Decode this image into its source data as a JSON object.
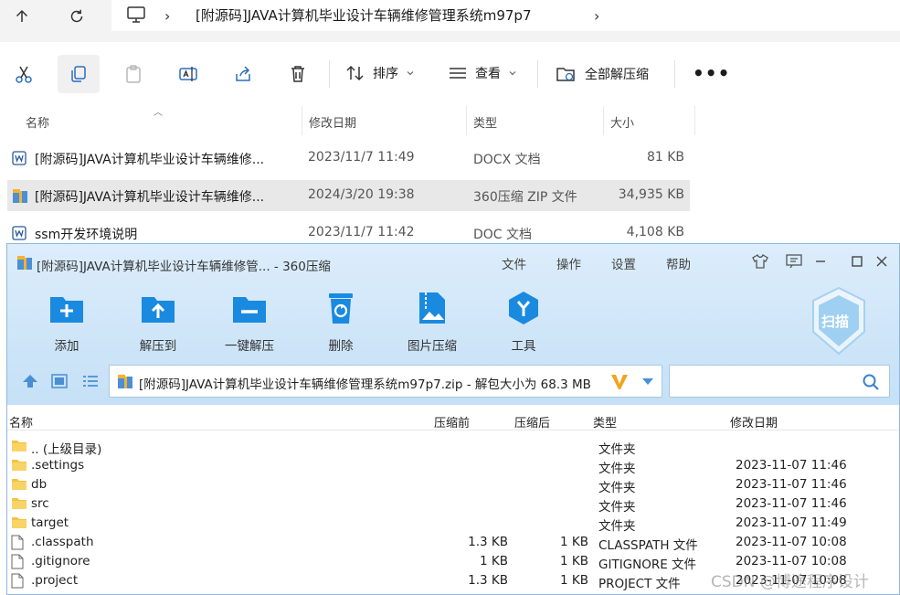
{
  "explorer": {
    "address": {
      "separator": "›",
      "folder": "[附源码]JAVA计算机毕业设计车辆维修管理系统m97p7"
    },
    "commands": {
      "sort_label": "排序",
      "view_label": "查看",
      "extract_all_label": "全部解压缩",
      "more_label": "•••"
    },
    "columns": {
      "name": "名称",
      "modified": "修改日期",
      "type": "类型",
      "size": "大小"
    },
    "files": [
      {
        "name": "[附源码]JAVA计算机毕业设计车辆维修...",
        "modified": "2023/11/7 11:49",
        "type": "DOCX 文档",
        "size": "81 KB",
        "icon": "word-doc-icon"
      },
      {
        "name": "[附源码]JAVA计算机毕业设计车辆维修...",
        "modified": "2024/3/20 19:38",
        "type": "360压缩 ZIP 文件",
        "size": "34,935 KB",
        "icon": "zip-archive-icon"
      },
      {
        "name": "ssm开发环境说明",
        "modified": "2023/11/7 11:42",
        "type": "DOC 文档",
        "size": "4,108 KB",
        "icon": "word-doc-icon"
      }
    ]
  },
  "zip": {
    "title": "[附源码]JAVA计算机毕业设计车辆维修管... - 360压缩",
    "menu": [
      "文件",
      "操作",
      "设置",
      "帮助"
    ],
    "toolbar": [
      "添加",
      "解压到",
      "一键解压",
      "删除",
      "图片压缩",
      "工具"
    ],
    "scan_label": "扫描",
    "path": "[附源码]JAVA计算机毕业设计车辆维修管理系统m97p7.zip - 解包大小为 68.3 MB",
    "columns": {
      "name": "名称",
      "packed": "压缩前",
      "compressed": "压缩后",
      "type": "类型",
      "modified": "修改日期"
    },
    "rows": [
      {
        "name": ".. (上级目录)",
        "packed": "",
        "compressed": "",
        "type": "文件夹",
        "modified": "",
        "icon": "folder"
      },
      {
        "name": ".settings",
        "packed": "",
        "compressed": "",
        "type": "文件夹",
        "modified": "2023-11-07 11:46",
        "icon": "folder"
      },
      {
        "name": "db",
        "packed": "",
        "compressed": "",
        "type": "文件夹",
        "modified": "2023-11-07 11:46",
        "icon": "folder"
      },
      {
        "name": "src",
        "packed": "",
        "compressed": "",
        "type": "文件夹",
        "modified": "2023-11-07 11:46",
        "icon": "folder"
      },
      {
        "name": "target",
        "packed": "",
        "compressed": "",
        "type": "文件夹",
        "modified": "2023-11-07 11:49",
        "icon": "folder"
      },
      {
        "name": ".classpath",
        "packed": "1.3 KB",
        "compressed": "1 KB",
        "type": "CLASSPATH 文件",
        "modified": "2023-11-07 10:08",
        "icon": "file"
      },
      {
        "name": ".gitignore",
        "packed": "1 KB",
        "compressed": "1 KB",
        "type": "GITIGNORE 文件",
        "modified": "2023-11-07 10:08",
        "icon": "file"
      },
      {
        "name": ".project",
        "packed": "1.3 KB",
        "compressed": "1 KB",
        "type": "PROJECT 文件",
        "modified": "2023-11-07 10:08",
        "icon": "file"
      }
    ]
  },
  "watermark": "CSDN @博途程序设计",
  "colors": {
    "accent_blue": "#1a8ae0",
    "zip_header": "#cfe6f8",
    "selection": "#e8e8e8",
    "folder": "#f5c242"
  }
}
